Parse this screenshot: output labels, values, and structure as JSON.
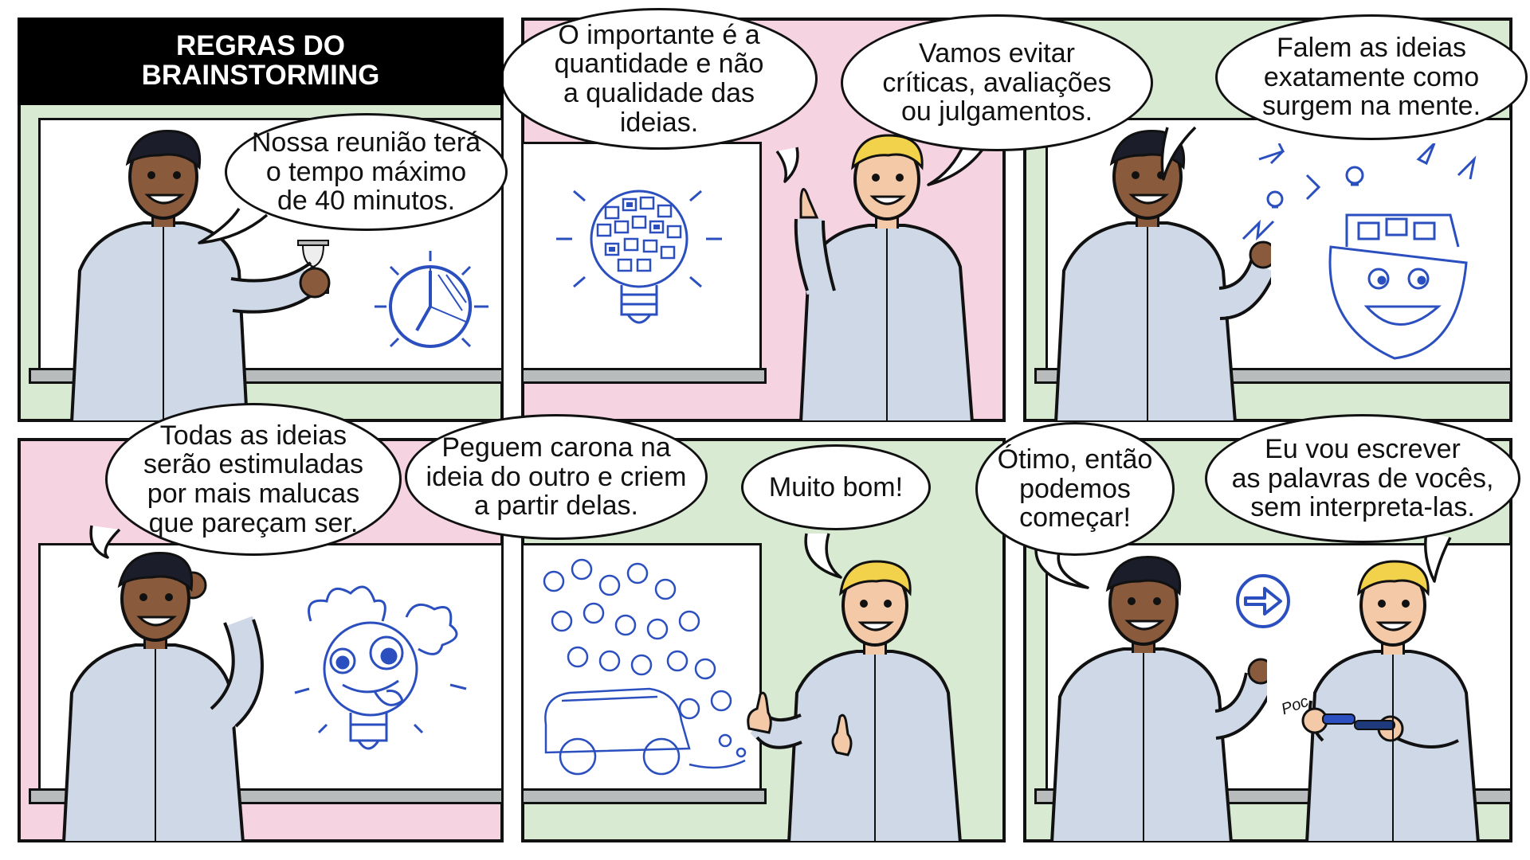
{
  "title": {
    "line1": "REGRAS DO",
    "line2": "BRAINSTORMING"
  },
  "colors": {
    "green_bg": "#d9ead3",
    "pink_bg": "#f5d3e1",
    "marker_blue": "#2b4fbf",
    "shirt": "#cfd8e6",
    "ledge": "#b8bcbc"
  },
  "panels": [
    {
      "bubble": [
        "Nossa reunião terá",
        "o tempo máximo",
        "de 40 minutos."
      ],
      "board_icons": [
        "hourglass-icon",
        "clock-icon"
      ]
    },
    {
      "bubble": [
        "O importante é a",
        "quantidade e não",
        "a qualidade das",
        "ideias."
      ],
      "board_icons": [
        "lightbulb-of-notes-icon"
      ]
    },
    {
      "bubble": [
        "Vamos evitar",
        "críticas, avaliações",
        "ou julgamentos."
      ],
      "board_icons": []
    },
    {
      "bubble": [
        "Falem as ideias",
        "exatamente como",
        "surgem na mente."
      ],
      "board_icons": [
        "ideas-from-head-icon"
      ]
    },
    {
      "bubble": [
        "Todas as ideias",
        "serão estimuladas",
        "por mais malucas",
        "que pareçam ser."
      ],
      "board_icons": [
        "crazy-lightbulb-icon"
      ]
    },
    {
      "bubble": [
        "Peguem carona na",
        "ideia do outro e criem",
        "a partir delas."
      ],
      "board_icons": [
        "car-of-ideas-icon"
      ]
    },
    {
      "bubble": [
        "Muito bom!"
      ],
      "board_icons": []
    },
    {
      "bubble_left": [
        "Ótimo, então",
        "podemos",
        "começar!"
      ],
      "bubble_right": [
        "Eu vou  escrever",
        "as palavras de vocês,",
        "sem interpreta-las."
      ],
      "board_icons": [
        "arrow-circle-icon"
      ],
      "sfx": "Poc"
    }
  ]
}
